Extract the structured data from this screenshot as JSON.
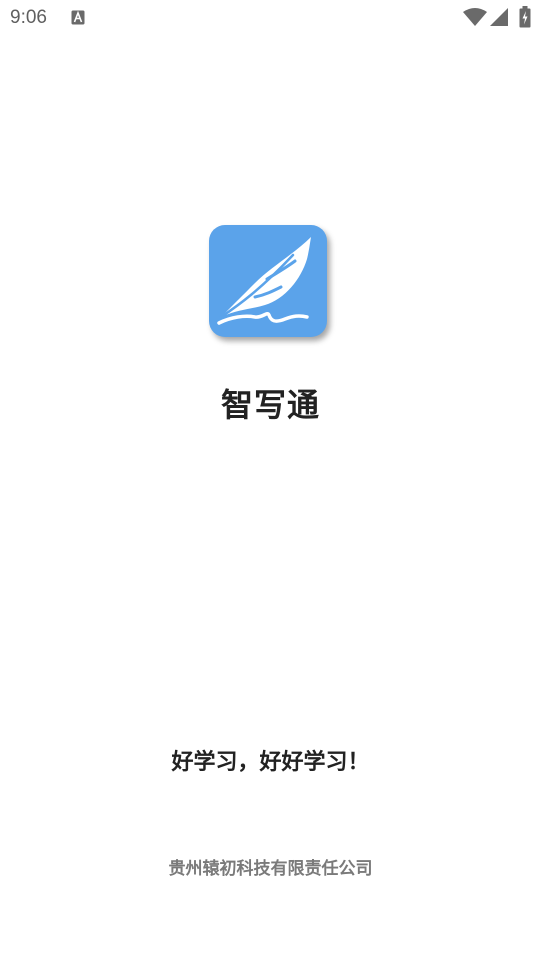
{
  "status_bar": {
    "time": "9:06",
    "notification_icon": "a-letter-icon",
    "wifi_icon": "wifi-icon",
    "signal_icon": "cell-signal-icon",
    "battery_icon": "battery-charging-icon"
  },
  "splash": {
    "logo_icon": "feather-quill-icon",
    "app_name": "智写通",
    "slogan": "好学习，好好学习！",
    "company": "贵州辕初科技有限责任公司"
  },
  "colors": {
    "logo_background": "#5ba3ea",
    "text_primary": "#222222",
    "text_secondary": "#7a7a7a",
    "background": "#ffffff"
  }
}
